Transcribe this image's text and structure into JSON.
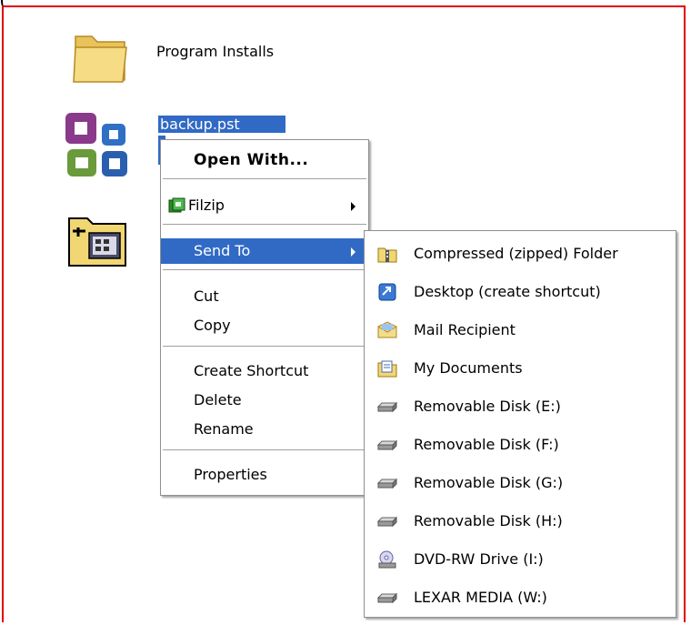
{
  "desktop": {
    "items": [
      {
        "label": "Program Installs",
        "icon": "folder-icon"
      },
      {
        "label": "backup.pst",
        "icon": "outlook-data-file-icon",
        "selected": true
      },
      {
        "label": "",
        "icon": "scheduled-tasks-folder-icon"
      }
    ]
  },
  "context_menu": {
    "open_with": "Open With...",
    "filzip": "Filzip",
    "send_to": "Send To",
    "cut": "Cut",
    "copy": "Copy",
    "create_shortcut": "Create Shortcut",
    "delete": "Delete",
    "rename": "Rename",
    "properties": "Properties"
  },
  "send_to_menu": {
    "items": [
      {
        "label": "Compressed (zipped) Folder",
        "icon": "zip-folder-icon"
      },
      {
        "label": "Desktop (create shortcut)",
        "icon": "desktop-shortcut-icon"
      },
      {
        "label": "Mail Recipient",
        "icon": "mail-icon"
      },
      {
        "label": "My Documents",
        "icon": "my-documents-icon"
      },
      {
        "label": "Removable Disk (E:)",
        "icon": "drive-icon"
      },
      {
        "label": "Removable Disk (F:)",
        "icon": "drive-icon"
      },
      {
        "label": "Removable Disk (G:)",
        "icon": "drive-icon"
      },
      {
        "label": "Removable Disk (H:)",
        "icon": "drive-icon"
      },
      {
        "label": "DVD-RW Drive (I:)",
        "icon": "dvd-drive-icon"
      },
      {
        "label": "LEXAR MEDIA (W:)",
        "icon": "drive-icon"
      }
    ]
  },
  "colors": {
    "selection": "#316ac5",
    "frame": "#e00000"
  }
}
